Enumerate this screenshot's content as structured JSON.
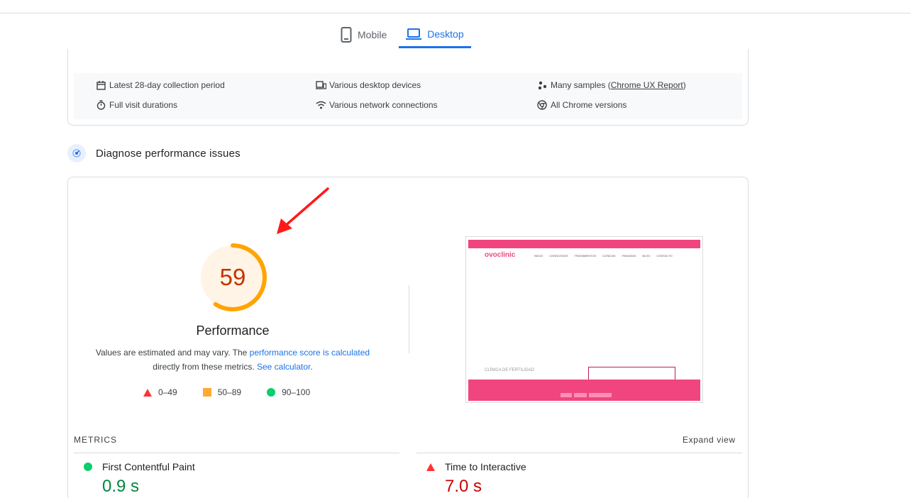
{
  "tabs": [
    {
      "label": "Mobile",
      "active": false
    },
    {
      "label": "Desktop",
      "active": true
    }
  ],
  "field_info": {
    "collection_period": "Latest 28-day collection period",
    "devices": "Various desktop devices",
    "samples_prefix": "Many samples (",
    "samples_link": "Chrome UX Report",
    "samples_suffix": ")",
    "visit_durations": "Full visit durations",
    "network": "Various network connections",
    "chrome_versions": "All Chrome versions"
  },
  "diagnose": {
    "title": "Diagnose performance issues"
  },
  "performance": {
    "score": "59",
    "score_fraction": 0.59,
    "label": "Performance",
    "desc_prefix": "Values are estimated and may vary. The ",
    "desc_link1": "performance score is calculated",
    "desc_mid": "directly from these metrics. ",
    "desc_link2": "See calculator",
    "desc_suffix": "."
  },
  "legend": [
    {
      "range": "0–49",
      "kind": "fail"
    },
    {
      "range": "50–89",
      "kind": "average"
    },
    {
      "range": "90–100",
      "kind": "pass"
    }
  ],
  "screenshot": {
    "logo": "ovoclinic",
    "nav": [
      "INICIO",
      "CONÓCENOS",
      "TRATAMIENTOS",
      "CLÍNICAS",
      "FINANZAS",
      "BLOG",
      "CONTACTO"
    ],
    "heading": "CLÍNICA DE FERTILIDAD"
  },
  "metrics": {
    "heading": "METRICS",
    "expand": "Expand view",
    "items": [
      {
        "name": "First Contentful Paint",
        "value": "0.9 s",
        "status": "pass"
      },
      {
        "name": "Time to Interactive",
        "value": "7.0 s",
        "status": "fail"
      }
    ]
  },
  "colors": {
    "accent": "#1a73e8",
    "fail": "#ff3333",
    "average": "#ffaa33",
    "pass": "#0cce6b",
    "score_text": "#c33300"
  }
}
